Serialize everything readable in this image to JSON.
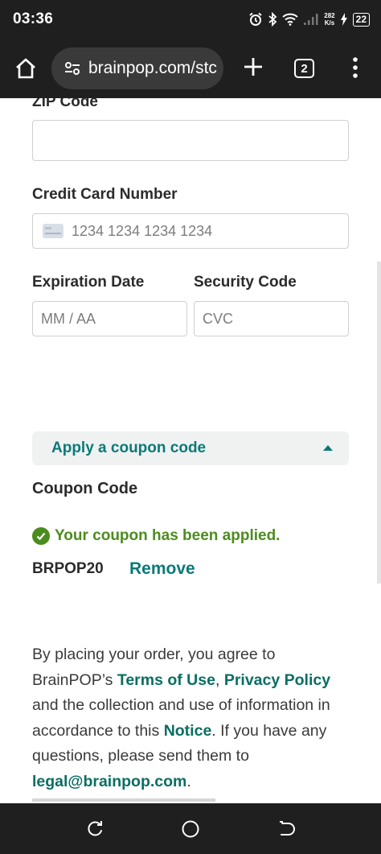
{
  "status_bar": {
    "time": "03:36",
    "net_speed_value": "282",
    "net_speed_unit": "K/s",
    "battery": "22",
    "icons": [
      "alarm-icon",
      "bluetooth-icon",
      "wifi-icon",
      "signal-icon",
      "charging-icon"
    ]
  },
  "browser": {
    "url": "brainpop.com/stc",
    "tab_count": "2",
    "icons": [
      "home-icon",
      "tune-icon",
      "plus-icon",
      "tabs-icon",
      "more-vert-icon"
    ]
  },
  "form": {
    "zip_label": "ZIP Code",
    "zip_value": "",
    "card_label": "Credit Card Number",
    "card_placeholder": "1234 1234 1234 1234",
    "exp_label": "Expiration Date",
    "exp_placeholder": "MM / AA",
    "cvc_label": "Security Code",
    "cvc_placeholder": "CVC"
  },
  "coupon": {
    "toggle_label": "Apply a coupon code",
    "heading": "Coupon Code",
    "applied_message": "Your coupon has been applied.",
    "code": "BRPOP20",
    "remove_label": "Remove"
  },
  "legal": {
    "part1": "By placing your order, you agree to BrainPOP’s ",
    "terms": "Terms of Use",
    "sep1": ", ",
    "privacy": "Privacy Policy",
    "part2": " and the collection and use of information in accordance to this ",
    "notice": "Notice",
    "part3": ". If you have any questions, please send them to ",
    "email": "legal@brainpop.com",
    "part4": "."
  },
  "colors": {
    "teal_link": "#0a7a78",
    "success_green": "#4c8c1f",
    "chrome_dark": "#1f1f1f"
  },
  "nav_icons": [
    "recents-icon",
    "home-circle-icon",
    "back-icon"
  ]
}
